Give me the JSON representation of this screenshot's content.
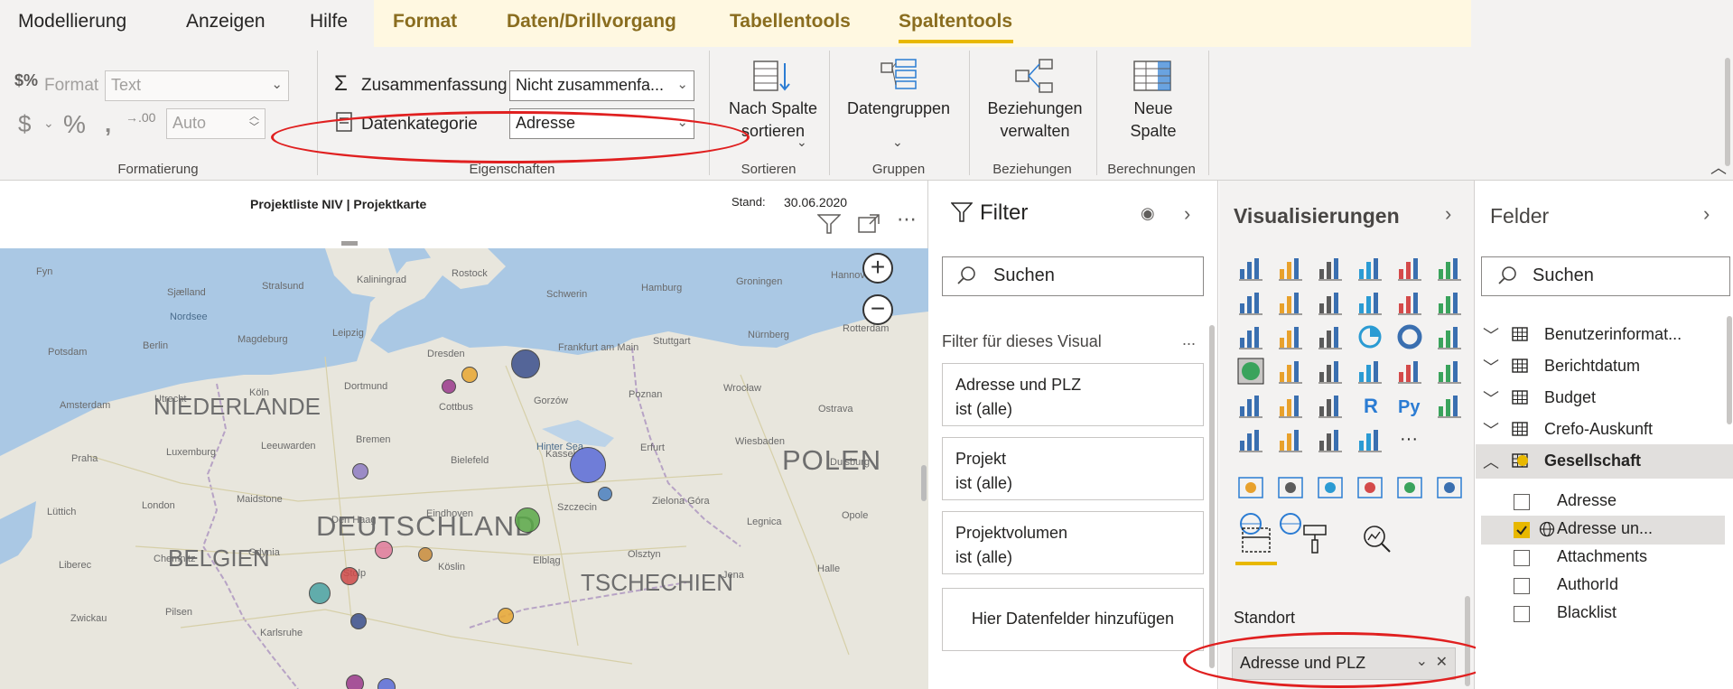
{
  "tabs": {
    "modellierung": "Modellierung",
    "anzeigen": "Anzeigen",
    "hilfe": "Hilfe",
    "format": "Format",
    "daten": "Daten/Drillvorgang",
    "tabellentools": "Tabellentools",
    "spaltentools": "Spaltentools"
  },
  "ribbon": {
    "format_label": "Format",
    "format_value": "Text",
    "decimal_value": "Auto",
    "formatierung_group": "Formatierung",
    "zusammenfassung_label": "Zusammenfassung",
    "zusammenfassung_value": "Nicht zusammenfa...",
    "datenkategorie_label": "Datenkategorie",
    "datenkategorie_value": "Adresse",
    "eigenschaften_group": "Eigenschaften",
    "sort_line1": "Nach Spalte",
    "sort_line2": "sortieren",
    "sortieren_group": "Sortieren",
    "datengruppen": "Datengruppen",
    "gruppen_group": "Gruppen",
    "bez_line1": "Beziehungen",
    "bez_line2": "verwalten",
    "beziehungen_group": "Beziehungen",
    "neue_line1": "Neue",
    "neue_line2": "Spalte",
    "berechnungen_group": "Berechnungen"
  },
  "report": {
    "title": "Projektliste NIV | Projektkarte",
    "stand_label": "Stand:",
    "stand_value": "30.06.2020"
  },
  "map": {
    "labels_big": [
      "NIEDERLANDE",
      "DEUTSCHLAND",
      "POLEN",
      "BELGIEN",
      "TSCHECHIEN"
    ],
    "nordsee": "Nordsee",
    "hinter_sea": "Hinter Sea",
    "cities": [
      "Fyn",
      "Sjælland",
      "Stralsund",
      "Kaliningrad",
      "Rostock",
      "Schwerin",
      "Hamburg",
      "Groningen",
      "Hannover",
      "Potsdam",
      "Berlin",
      "Magdeburg",
      "Leipzig",
      "Dresden",
      "Frankfurt am Main",
      "Stuttgart",
      "Nürnberg",
      "Rotterdam",
      "Amsterdam",
      "Utrecht",
      "Köln",
      "Dortmund",
      "Cottbus",
      "Gorzów",
      "Poznan",
      "Wrocław",
      "Ostrava",
      "Praha",
      "Luxemburg",
      "Leeuwarden",
      "Bremen",
      "Bielefeld",
      "Kassel",
      "Erfurt",
      "Wiesbaden",
      "Duisburg",
      "Lüttich",
      "London",
      "Maidstone",
      "Den Haag",
      "Eindhoven",
      "Szczecin",
      "Zielona Góra",
      "Legnica",
      "Opole",
      "Liberec",
      "Chemnitz",
      "Gdynia",
      "Stolp",
      "Köslin",
      "Elbląg",
      "Olsztyn",
      "Jena",
      "Halle",
      "Zwickau",
      "Pilsen",
      "Karlsruhe"
    ],
    "bubble_colors": [
      "#3b4f8c",
      "#e8a732",
      "#9b3a8c",
      "#5b6bd8",
      "#4a7fbf",
      "#5aa848",
      "#8e7cc3",
      "#e07b9b",
      "#c98c3b",
      "#cf4a4a",
      "#4aa3a3"
    ]
  },
  "filter_pane": {
    "title": "Filter",
    "search_placeholder": "Suchen",
    "subtitle": "Filter für dieses Visual",
    "more": "...",
    "cards": [
      {
        "name": "Adresse und PLZ",
        "state": "ist (alle)"
      },
      {
        "name": "Projekt",
        "state": "ist (alle)"
      },
      {
        "name": "Projektvolumen",
        "state": "ist (alle)"
      }
    ],
    "add_fields": "Hier Datenfelder hinzufügen"
  },
  "vis_pane": {
    "title": "Visualisierungen",
    "more": "...",
    "well_label": "Standort",
    "well_value": "Adresse und PLZ"
  },
  "fields_pane": {
    "title": "Felder",
    "search_placeholder": "Suchen",
    "tables": [
      "Benutzerinformat...",
      "Berichtdatum",
      "Budget",
      "Crefo-Auskunft",
      "Gesellschaft"
    ],
    "columns": [
      {
        "name": "Adresse",
        "checked": false
      },
      {
        "name": "Adresse un...",
        "checked": true
      },
      {
        "name": "Attachments",
        "checked": false
      },
      {
        "name": "AuthorId",
        "checked": false
      },
      {
        "name": "Blacklist",
        "checked": false
      }
    ]
  },
  "colors": {
    "accent": "#e8b800",
    "annotation": "#e02020",
    "context_tab": "#8a6d1f"
  }
}
